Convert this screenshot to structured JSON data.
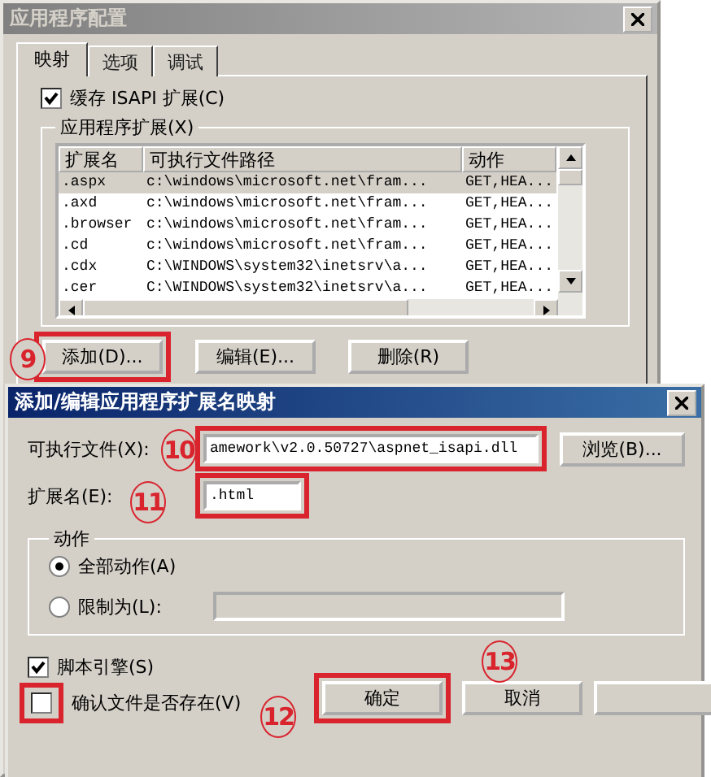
{
  "main_window": {
    "title": "应用程序配置",
    "tabs": [
      {
        "label": "映射",
        "selected": true
      },
      {
        "label": "选项",
        "selected": false
      },
      {
        "label": "调试",
        "selected": false
      }
    ],
    "cache_isapi": {
      "label": "缓存 ISAPI 扩展(C)",
      "checked": true
    },
    "extensions": {
      "label": "应用程序扩展(X)",
      "columns": [
        "扩展名",
        "可执行文件路径",
        "动作"
      ],
      "rows": [
        {
          "cells": [
            ".aspx",
            "c:\\windows\\microsoft.net\\fram...",
            "GET,HEA..."
          ],
          "selected": true
        },
        {
          "cells": [
            ".axd",
            "c:\\windows\\microsoft.net\\fram...",
            "GET,HEA..."
          ],
          "selected": false
        },
        {
          "cells": [
            ".browser",
            "c:\\windows\\microsoft.net\\fram...",
            "GET,HEA..."
          ],
          "selected": false
        },
        {
          "cells": [
            ".cd",
            "c:\\windows\\microsoft.net\\fram...",
            "GET,HEA..."
          ],
          "selected": false
        },
        {
          "cells": [
            ".cdx",
            "C:\\WINDOWS\\system32\\inetsrv\\a...",
            "GET,HEA..."
          ],
          "selected": false
        },
        {
          "cells": [
            ".cer",
            "C:\\WINDOWS\\system32\\inetsrv\\a...",
            "GET,HEA..."
          ],
          "selected": false
        }
      ]
    },
    "buttons": [
      {
        "label": "添加(D)...",
        "highlighted": true
      },
      {
        "label": "编辑(E)...",
        "highlighted": false
      },
      {
        "label": "删除(R)",
        "highlighted": false
      }
    ]
  },
  "dialog": {
    "title": "添加/编辑应用程序扩展名映射",
    "executable": {
      "label": "可执行文件(X):",
      "value": "amework\\v2.0.50727\\aspnet_isapi.dll"
    },
    "browse": "浏览(B)...",
    "extension": {
      "label": "扩展名(E):",
      "value": ".html"
    },
    "verbs": {
      "label": "动作",
      "options": [
        {
          "label": "全部动作(A)",
          "selected": true
        },
        {
          "label": "限制为(L):",
          "selected": false
        }
      ]
    },
    "script_engine": {
      "label": "脚本引擎(S)",
      "checked": true
    },
    "verify_file": {
      "label": "确认文件是否存在(V)",
      "checked": false
    },
    "buttons": [
      {
        "label": "确定",
        "highlighted": true
      },
      {
        "label": "取消",
        "highlighted": false
      }
    ]
  },
  "annotations": [
    "9",
    "10",
    "11",
    "12",
    "13"
  ]
}
